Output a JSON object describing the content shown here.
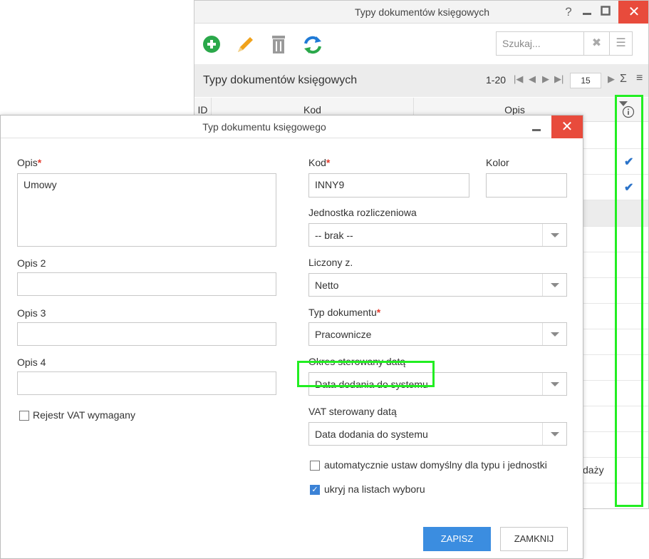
{
  "background_window": {
    "title": "Typy dokumentów księgowych",
    "help": "?",
    "search_placeholder": "Szukaj...",
    "grid_title": "Typy dokumentów księgowych",
    "pager_range": "1-20",
    "page_size": "15",
    "columns": [
      "ID",
      "Kod",
      "Opis"
    ],
    "visible_fragment": "daży"
  },
  "dialog": {
    "title": "Typ dokumentu księgowego",
    "fields": {
      "opis_label": "Opis",
      "opis_value": "Umowy",
      "opis2_label": "Opis 2",
      "opis3_label": "Opis 3",
      "opis4_label": "Opis 4",
      "kod_label": "Kod",
      "kod_value": "INNY9",
      "kolor_label": "Kolor",
      "jednostka_label": "Jednostka rozliczeniowa",
      "jednostka_value": "-- brak --",
      "liczony_label": "Liczony z.",
      "liczony_value": "Netto",
      "typ_label": "Typ dokumentu",
      "typ_value": "Pracownicze",
      "okres_label": "Okres sterowany datą",
      "okres_value": "Data dodania do systemu",
      "vat_label": "VAT sterowany datą",
      "vat_value": "Data dodania do systemu"
    },
    "checkboxes": {
      "rejestr_vat": "Rejestr VAT wymagany",
      "auto_default": "automatycznie ustaw domyślny dla typu i jednostki",
      "hide_on_lists": "ukryj na listach wyboru"
    },
    "buttons": {
      "save": "ZAPISZ",
      "close": "ZAMKNIJ"
    }
  },
  "colors": {
    "close_red": "#e84b3c",
    "primary_blue": "#3b8de0",
    "highlight_green": "#22ee22",
    "required_red": "#e53a2c"
  }
}
